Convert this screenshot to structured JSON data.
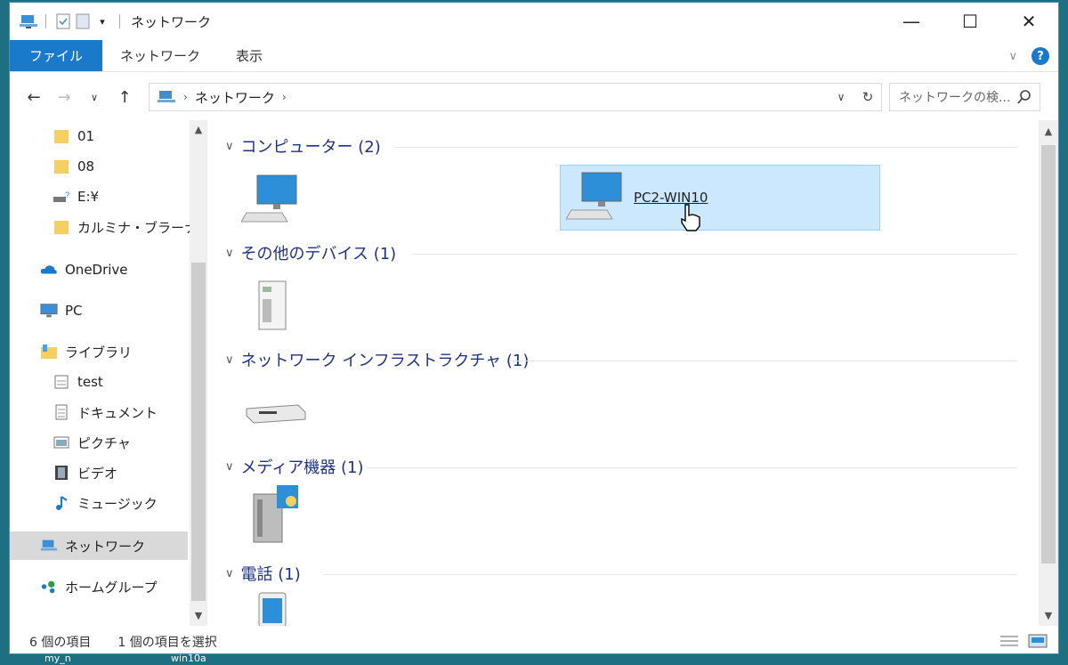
{
  "window": {
    "title": "ネットワーク"
  },
  "ribbon": {
    "tabs": [
      "ファイル",
      "ネットワーク",
      "表示"
    ]
  },
  "address": {
    "crumb": "ネットワーク",
    "search_placeholder": "ネットワークの検..."
  },
  "nav": {
    "items": [
      "01",
      "08",
      "E:¥",
      "カルミナ・ブラーナ",
      "OneDrive",
      "PC",
      "ライブラリ",
      "test",
      "ドキュメント",
      "ピクチャ",
      "ビデオ",
      "ミュージック",
      "ネットワーク",
      "ホームグループ"
    ]
  },
  "groups": [
    {
      "header": "コンピューター (2)"
    },
    {
      "header": "その他のデバイス (1)"
    },
    {
      "header": "ネットワーク インフラストラクチャ (1)"
    },
    {
      "header": "メディア機器 (1)"
    },
    {
      "header": "電話 (1)"
    }
  ],
  "items": {
    "pc2": "PC2-WIN10"
  },
  "status": {
    "count": "6 個の項目",
    "selected": "1 個の項目を選択"
  },
  "desktop": {
    "label1": "my_n",
    "label2": "win10a"
  },
  "colors": {
    "accent": "#1979ca",
    "selection": "#cce8ff",
    "header": "#1e3287"
  }
}
